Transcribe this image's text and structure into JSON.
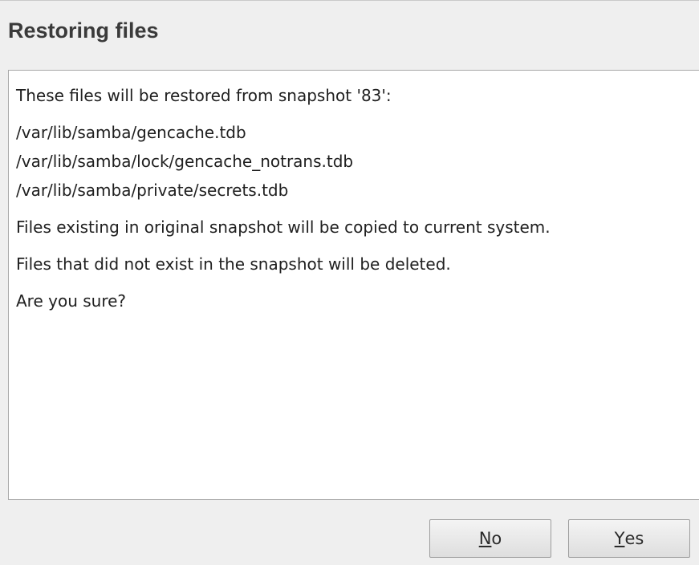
{
  "dialog": {
    "title": "Restoring files",
    "intro": "These files will be restored from snapshot '83':",
    "files": [
      "/var/lib/samba/gencache.tdb",
      "/var/lib/samba/lock/gencache_notrans.tdb",
      "/var/lib/samba/private/secrets.tdb"
    ],
    "note_copy": "Files existing in original snapshot will be copied to current system.",
    "note_delete": "Files that did not exist in the snapshot will be deleted.",
    "question": "Are you sure?"
  },
  "buttons": {
    "no": {
      "mnemonic": "N",
      "rest": "o"
    },
    "yes": {
      "mnemonic": "Y",
      "rest": "es"
    }
  }
}
